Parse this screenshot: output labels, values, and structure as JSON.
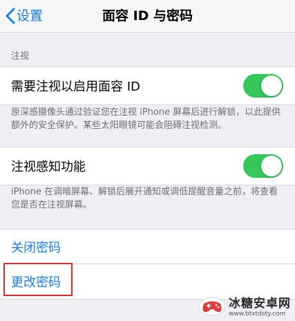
{
  "nav": {
    "back_label": "设置",
    "title": "面容 ID 与密码"
  },
  "section_header": "注视",
  "require_attention": {
    "label": "需要注视以启用面容 ID",
    "enabled": true
  },
  "require_attention_footer": "原深感摄像头通过验证您在注视 iPhone 屏幕后进行解锁，以此提供额外的安全保护。某些太阳眼镜可能会阻碍注视检测。",
  "attention_aware": {
    "label": "注视感知功能",
    "enabled": true
  },
  "attention_aware_footer": "iPhone 在调暗屏幕、解锁后展开通知或调低提醒音量之前，将查看您是否在注视屏幕。",
  "passcode": {
    "turn_off_label": "关闭密码",
    "change_label": "更改密码"
  },
  "watermark": {
    "title": "冰糖安卓网",
    "url": "www.btxtdsty.com"
  },
  "colors": {
    "accent": "#1a7cf3",
    "toggle_on": "#34c759",
    "highlight": "#e02a2a",
    "background": "#efeff4"
  }
}
